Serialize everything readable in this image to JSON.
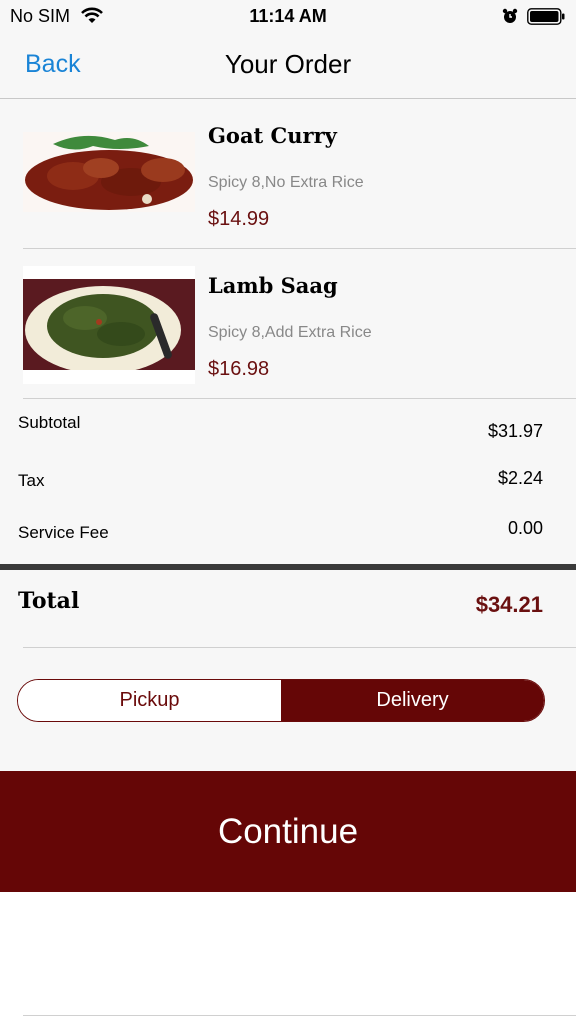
{
  "status_bar": {
    "carrier": "No SIM",
    "time": "11:14 AM"
  },
  "nav": {
    "back_label": "Back",
    "title": "Your Order"
  },
  "items": [
    {
      "name": "Goat Curry",
      "options": "Spicy 8,No Extra Rice",
      "price": "$14.99"
    },
    {
      "name": "Lamb Saag",
      "options": "Spicy 8,Add Extra Rice",
      "price": "$16.98"
    }
  ],
  "summary": {
    "subtotal_label": "Subtotal",
    "subtotal_value": "$31.97",
    "tax_label": "Tax",
    "tax_value": "$2.24",
    "service_fee_label": "Service Fee",
    "service_fee_value": "0.00"
  },
  "total": {
    "label": "Total",
    "value": "$34.21"
  },
  "order_type": {
    "options": [
      "Pickup",
      "Delivery"
    ],
    "selected": "Delivery"
  },
  "continue_label": "Continue",
  "colors": {
    "accent": "#650606",
    "price": "#6a1010",
    "link": "#1a84d6"
  }
}
